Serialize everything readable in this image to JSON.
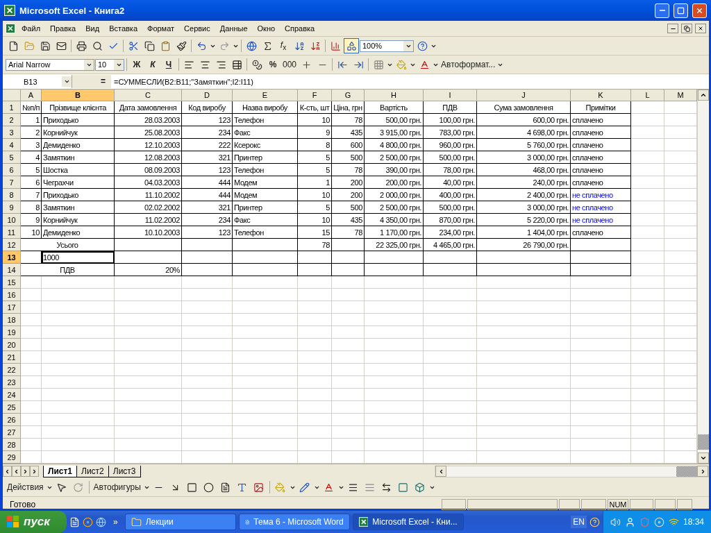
{
  "window": {
    "title": "Microsoft Excel - Книга2"
  },
  "menu": [
    "Файл",
    "Правка",
    "Вид",
    "Вставка",
    "Формат",
    "Сервис",
    "Данные",
    "Окно",
    "Справка"
  ],
  "standard_toolbar": {
    "function_button": "*f*$_{x}$",
    "zoom": "100%"
  },
  "formatting_toolbar": {
    "font": "Arial Narrow",
    "size": "10",
    "bold": "Ж",
    "italic": "К",
    "underline": "Ч",
    "percent": "%",
    "thousands": "000",
    "autoformat": "Автоформат..."
  },
  "formula_bar": {
    "name_box": "B13",
    "equals": "=",
    "formula": "=СУММЕСЛИ(B2:B11;\"Замяткин\";I2:I11)"
  },
  "sheet": {
    "columns": [
      {
        "label": "A",
        "selected": false
      },
      {
        "label": "B",
        "selected": true
      },
      {
        "label": "C",
        "selected": false
      },
      {
        "label": "D",
        "selected": false
      },
      {
        "label": "E",
        "selected": false
      },
      {
        "label": "F",
        "selected": false
      },
      {
        "label": "G",
        "selected": false
      },
      {
        "label": "H",
        "selected": false
      },
      {
        "label": "I",
        "selected": false
      },
      {
        "label": "J",
        "selected": false
      },
      {
        "label": "K",
        "selected": false
      },
      {
        "label": "L",
        "selected": false
      },
      {
        "label": "M",
        "selected": false
      }
    ],
    "rows": [
      {
        "number": "1",
        "selected": false,
        "kind": "header",
        "cells": [
          "№п/п",
          "Прізвище клієнта",
          "Дата замовлення",
          "Код виробу",
          "Назва виробу",
          "К-сть, шт",
          "Ціна, грн",
          "Вартість",
          "ПДВ",
          "Сума замовлення",
          "Примітки"
        ]
      },
      {
        "number": "2",
        "selected": false,
        "kind": "data",
        "cells": [
          "1",
          "Приходько",
          "28.03.2003",
          "123",
          "Телефон",
          "10",
          "78",
          "500,00 грн.",
          "100,00 грн.",
          "600,00 грн.",
          "сплачено"
        ]
      },
      {
        "number": "3",
        "selected": false,
        "kind": "data",
        "cells": [
          "2",
          "Корнийчук",
          "25.08.2003",
          "234",
          "Факс",
          "9",
          "435",
          "3 915,00 грн.",
          "783,00 грн.",
          "4 698,00 грн.",
          "сплачено"
        ]
      },
      {
        "number": "4",
        "selected": false,
        "kind": "data",
        "cells": [
          "3",
          "Демиденко",
          "12.10.2003",
          "222",
          "Ксерокс",
          "8",
          "600",
          "4 800,00 грн.",
          "960,00 грн.",
          "5 760,00 грн.",
          "сплачено"
        ]
      },
      {
        "number": "5",
        "selected": false,
        "kind": "data",
        "cells": [
          "4",
          "Замяткин",
          "12.08.2003",
          "321",
          "Принтер",
          "5",
          "500",
          "2 500,00 грн.",
          "500,00 грн.",
          "3 000,00 грн.",
          "сплачено"
        ]
      },
      {
        "number": "6",
        "selected": false,
        "kind": "data",
        "cells": [
          "5",
          "Шостка",
          "08.09.2003",
          "123",
          "Телефон",
          "5",
          "78",
          "390,00 грн.",
          "78,00 грн.",
          "468,00 грн.",
          "сплачено"
        ]
      },
      {
        "number": "7",
        "selected": false,
        "kind": "data",
        "cells": [
          "6",
          "Чеграхчи",
          "04.03.2003",
          "444",
          "Модем",
          "1",
          "200",
          "200,00 грн.",
          "40,00 грн.",
          "240,00 грн.",
          "сплачено"
        ]
      },
      {
        "number": "8",
        "selected": false,
        "kind": "data",
        "cells": [
          "7",
          "Приходько",
          "11.10.2002",
          "444",
          "Модем",
          "10",
          "200",
          "2 000,00 грн.",
          "400,00 грн.",
          "2 400,00 грн.",
          {
            "text": "не сплачено",
            "color": "#0000ff"
          }
        ]
      },
      {
        "number": "9",
        "selected": false,
        "kind": "data",
        "cells": [
          "8",
          "Замяткин",
          "02.02.2002",
          "321",
          "Принтер",
          "5",
          "500",
          "2 500,00 грн.",
          "500,00 грн.",
          "3 000,00 грн.",
          {
            "text": "не сплачено",
            "color": "#0000ff"
          }
        ]
      },
      {
        "number": "10",
        "selected": false,
        "kind": "data",
        "cells": [
          "9",
          "Корнийчук",
          "11.02.2002",
          "234",
          "Факс",
          "10",
          "435",
          "4 350,00 грн.",
          "870,00 грн.",
          "5 220,00 грн.",
          {
            "text": "не сплачено",
            "color": "#0000ff"
          }
        ]
      },
      {
        "number": "11",
        "selected": false,
        "kind": "data",
        "cells": [
          "10",
          "Демиденко",
          "10.10.2003",
          "123",
          "Телефон",
          "15",
          "78",
          "1 170,00 грн.",
          "234,00 грн.",
          "1 404,00 грн.",
          "сплачено"
        ]
      },
      {
        "number": "12",
        "selected": false,
        "kind": "data",
        "cells": [
          "Усього",
          null,
          null,
          null,
          null,
          "78",
          null,
          "22 325,00 грн.",
          "4 465,00 грн.",
          "26 790,00 грн.",
          null
        ]
      },
      {
        "number": "13",
        "selected": true,
        "kind": "data",
        "cells": [
          null,
          "1000",
          null,
          null,
          null,
          null,
          null,
          null,
          null,
          null,
          null
        ]
      },
      {
        "number": "14",
        "selected": false,
        "kind": "data",
        "cells": [
          "ПДВ",
          null,
          "20%",
          null,
          null,
          null,
          null,
          null,
          null,
          null,
          null
        ]
      },
      {
        "number": "15",
        "selected": false
      },
      {
        "number": "16",
        "selected": false
      },
      {
        "number": "17",
        "selected": false
      },
      {
        "number": "18",
        "selected": false
      },
      {
        "number": "19",
        "selected": false
      },
      {
        "number": "20",
        "selected": false
      },
      {
        "number": "21",
        "selected": false
      },
      {
        "number": "22",
        "selected": false
      },
      {
        "number": "23",
        "selected": false
      },
      {
        "number": "24",
        "selected": false
      },
      {
        "number": "25",
        "selected": false
      },
      {
        "number": "26",
        "selected": false
      },
      {
        "number": "27",
        "selected": false
      },
      {
        "number": "28",
        "selected": false
      },
      {
        "number": "29",
        "selected": false
      }
    ]
  },
  "sheet_tabs": [
    {
      "label": "Лист1",
      "selected": true
    },
    {
      "label": "Лист2",
      "selected": false
    },
    {
      "label": "Лист3",
      "selected": false
    }
  ],
  "drawing_toolbar": {
    "actions": "Действия",
    "autoshapes": "Автофигуры"
  },
  "status_bar": {
    "status": "Готово",
    "indicator": "NUM"
  },
  "taskbar": {
    "start": "пуск",
    "more": "»",
    "tasks": [
      {
        "label": "Лекции",
        "kind": "folder",
        "selected": false
      },
      {
        "label": "Тема 6 - Microsoft Word",
        "kind": "word",
        "selected": false
      },
      {
        "label": "Microsoft Excel - Кни...",
        "kind": "excel",
        "selected": true
      }
    ],
    "language": "EN",
    "clock": "18:34"
  }
}
